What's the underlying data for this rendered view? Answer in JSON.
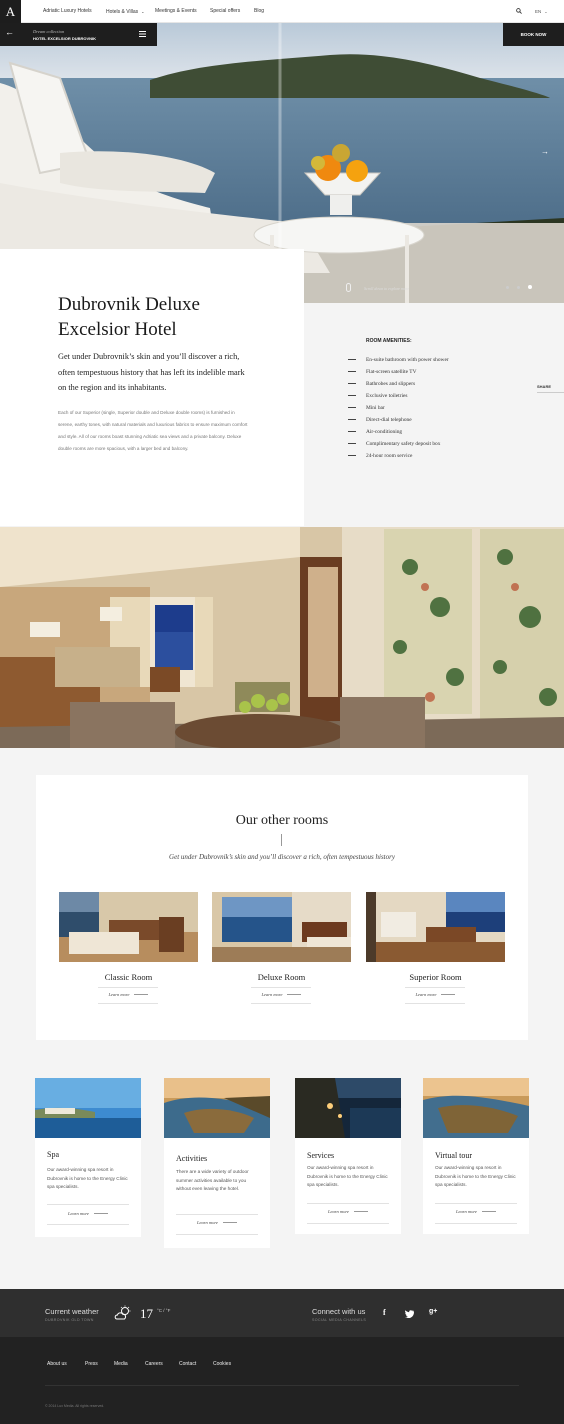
{
  "nav": {
    "logo": "A",
    "links": [
      "Adriatic Luxury Hotels",
      "Hotels & Villas",
      "Meetings & Events",
      "Special offers",
      "Blog"
    ],
    "lang": "EN"
  },
  "hero": {
    "back_glyph": "←",
    "collection": "Dream collection",
    "hotel": "HOTEL EXCELSIOR DUBROVNIK",
    "book": "BOOK NOW",
    "next_glyph": "→",
    "scroll_hint": "Scroll down to explore more"
  },
  "intro": {
    "title_line1": "Dubrovnik Deluxe",
    "title_line2": "Excelsior Hotel",
    "lead": "Get under Dubrovnik’s skin and you’ll discover a rich, often tempestuous history that has left its indelible mark on the region and its inhabitants.",
    "body": "Each of our Superior (single, Superior double and Deluxe double rooms) is furnished in serene, earthy tones, with natural materials and luxurious fabrics to ensure maximum comfort and style. All of our rooms boast stunning Adriatic sea views and a private balcony. Deluxe double rooms are more spacious, with a larger bed and balcony."
  },
  "amenities": {
    "title": "ROOM AMENITIES:",
    "items": [
      "En-suite bathroom with power shower",
      "Flat-screen satellite TV",
      "Bathrobes and slippers",
      "Exclusive toiletries",
      "Mini bar",
      "Direct-dial telephone",
      "Air-conditioning",
      "Complimentary safety deposit box",
      "24-hour room service"
    ]
  },
  "share": "SHARE",
  "rooms": {
    "title": "Our other rooms",
    "subtitle": "Get under Dubrovnik’s skin and you’ll discover a rich, often tempestuous history",
    "items": [
      {
        "name": "Classic Room",
        "link": "Learn more"
      },
      {
        "name": "Deluxe Room",
        "link": "Learn more"
      },
      {
        "name": "Superior Room",
        "link": "Learn more"
      }
    ]
  },
  "features": [
    {
      "title": "Spa",
      "text": "Our award-winning spa resort in Dubrovnik is home to the Energy Clinic spa specialists.",
      "link": "Learn more"
    },
    {
      "title": "Activities",
      "text": "There are a wide variety of outdoor summer activities available to you without even leaving the hotel.",
      "link": "Learn more"
    },
    {
      "title": "Services",
      "text": "Our award-winning spa resort in Dubrovnik is home to the Energy Clinic spa specialists.",
      "link": "Learn more"
    },
    {
      "title": "Virtual tour",
      "text": "Our award-winning spa resort in Dubrovnik is home to the Energy Clinic spa specialists.",
      "link": "Learn more"
    }
  ],
  "weather": {
    "title": "Current weather",
    "place": "DUBROVNIK OLD TOWN",
    "temp": "17",
    "unit": "°C / °F",
    "icon": "partly-cloudy-icon"
  },
  "connect": {
    "title": "Connect with us",
    "sub": "SOCIAL MEDIA CHANNELS",
    "icons": [
      "f",
      "t",
      "g+"
    ]
  },
  "footer": {
    "links": [
      "About us",
      "Press",
      "Media",
      "Careers",
      "Contact",
      "Cookies"
    ],
    "copyright": "© 2014 Lux Media. All rights reserved."
  }
}
